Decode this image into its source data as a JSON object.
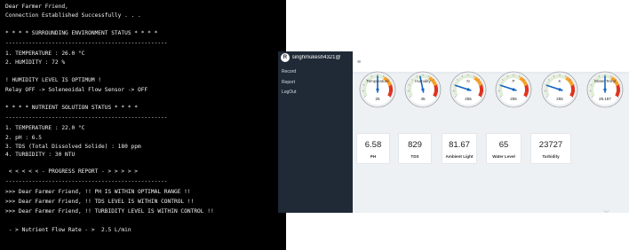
{
  "terminal": {
    "lines": [
      "Dear Farmer Friend,",
      "Connection Established Successfully . . .",
      "* * * * SURROUNDING ENVIRONMENT STATUS * * * *",
      "-------------------------------------------------",
      "1. TEMPERATURE : 26.0 °C",
      "2. HUMIDITY : 72 %",
      "! HUMIDITY LEVEL IS OPTIMUM !",
      "Relay OFF -> Soleneoidal Flow Sensor -> OFF",
      "* * * * NUTRIENT SOLUTION STATUS * * * *",
      "-------------------------------------------------",
      "1. TEMPERATURE : 22.0 °C",
      "2. pH : 6.5",
      "3. TDS (Total Dissolved Solide) : 180 ppm",
      "4. TURBIDITY : 30 NTU",
      " < < < < < - PROGRESS REPORT - > > > > >",
      "-------------------------------------------------",
      ">>> Dear Farmer Friend, !! PH IS WITHIN OPTIMAL RANGE !!",
      ">>> Dear Farmer Friend, !! TDS LEVEL IS WITHIN CONTROL !!",
      ">>> Dear Farmer Friend, !! TURBIDITY LEVEL IS WITHIN CONTROL !!",
      " - > Nutrient Flow Rate - >  2.5 L/min"
    ]
  },
  "sidebar": {
    "avatar_letter": "R",
    "user": "singhmukesh4321@",
    "items": [
      "Record",
      "Report",
      "LogOut"
    ]
  },
  "header": {
    "menu_icon": "≡"
  },
  "gauges": [
    {
      "label": "Temperature",
      "value": "25",
      "fraction": 0.5
    },
    {
      "label": "Humidity",
      "value": "45",
      "fraction": 0.45
    },
    {
      "label": "N",
      "value": "255",
      "fraction": 0.2
    },
    {
      "label": "P",
      "value": "255",
      "fraction": 0.2
    },
    {
      "label": "K",
      "value": "255",
      "fraction": 0.2
    },
    {
      "label": "Water Temp",
      "value": "25.187",
      "fraction": 0.5
    }
  ],
  "cards": [
    {
      "value": "6.58",
      "label": "PH"
    },
    {
      "value": "829",
      "label": "TDS"
    },
    {
      "value": "81.67",
      "label": "Ambient Light"
    },
    {
      "value": "65",
      "label": "Water Level"
    },
    {
      "value": "23727",
      "label": "Turbidity"
    }
  ],
  "colors": {
    "terminal_bg": "#000000",
    "sidebar_bg": "#1f2a36",
    "needle": "#1565c0",
    "zone_green": "#e0ecd6",
    "zone_orange": "#f4a12a",
    "zone_red": "#e2321f"
  }
}
